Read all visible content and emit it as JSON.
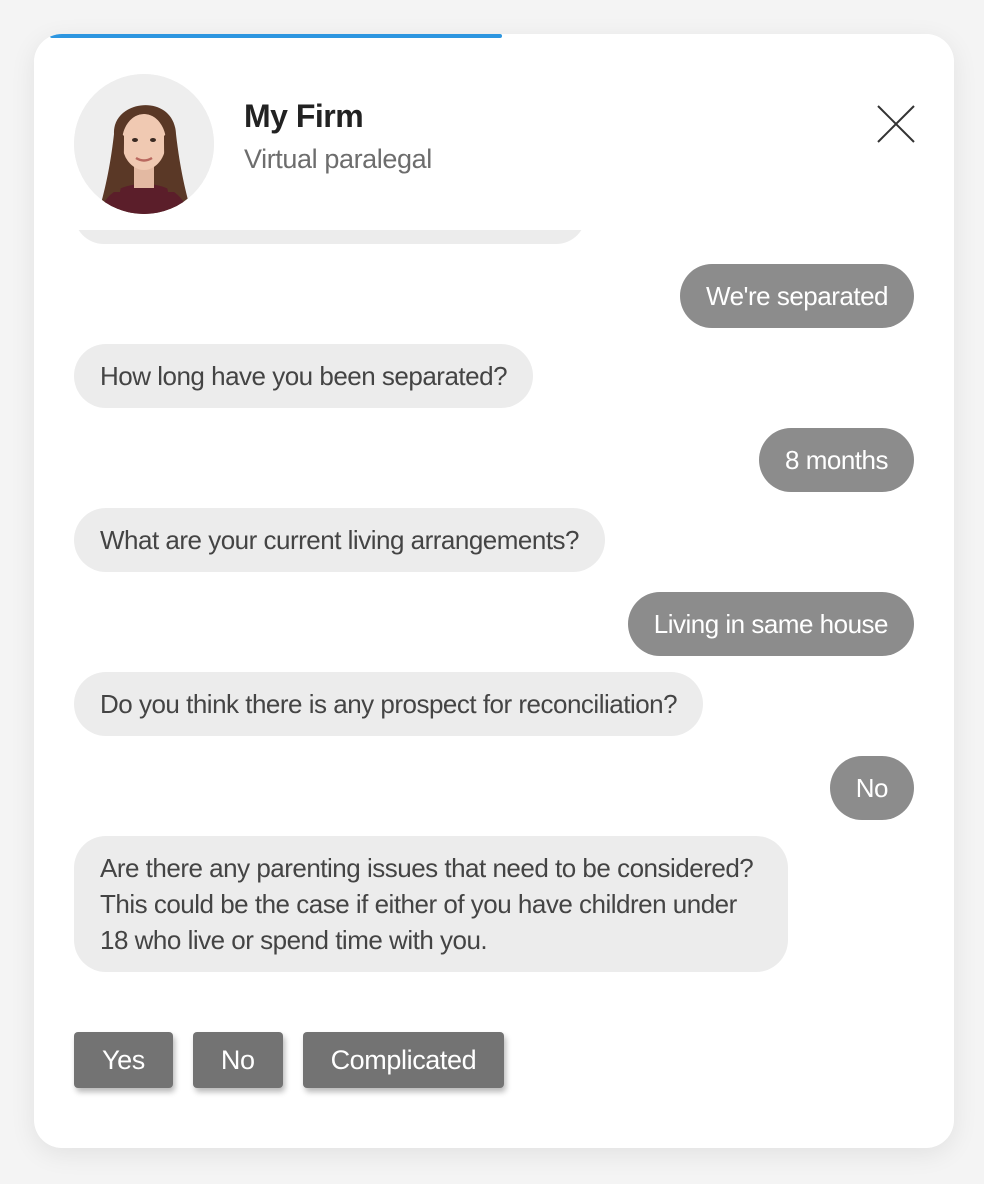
{
  "header": {
    "firm_name": "My Firm",
    "subtitle": "Virtual paralegal",
    "close_icon": "close-icon",
    "avatar_icon": "avatar"
  },
  "progress": {
    "fraction": 0.5,
    "color": "#2d96e0"
  },
  "messages": [
    {
      "from": "user",
      "text": "We're separated"
    },
    {
      "from": "bot",
      "text": "How long have you been separated?"
    },
    {
      "from": "user",
      "text": "8 months"
    },
    {
      "from": "bot",
      "text": "What are your current living arrangements?"
    },
    {
      "from": "user",
      "text": "Living in same house"
    },
    {
      "from": "bot",
      "text": "Do you think there is any prospect for reconciliation?"
    },
    {
      "from": "user",
      "text": "No"
    },
    {
      "from": "bot",
      "text": "Are there any parenting issues that need to be considered? This could be the case if either of you have children under 18 who live or spend time with you."
    }
  ],
  "options": [
    {
      "label": "Yes"
    },
    {
      "label": "No"
    },
    {
      "label": "Complicated"
    }
  ],
  "colors": {
    "bot_bubble": "#ececec",
    "user_bubble": "#8c8c8c",
    "option_button": "#737373"
  }
}
